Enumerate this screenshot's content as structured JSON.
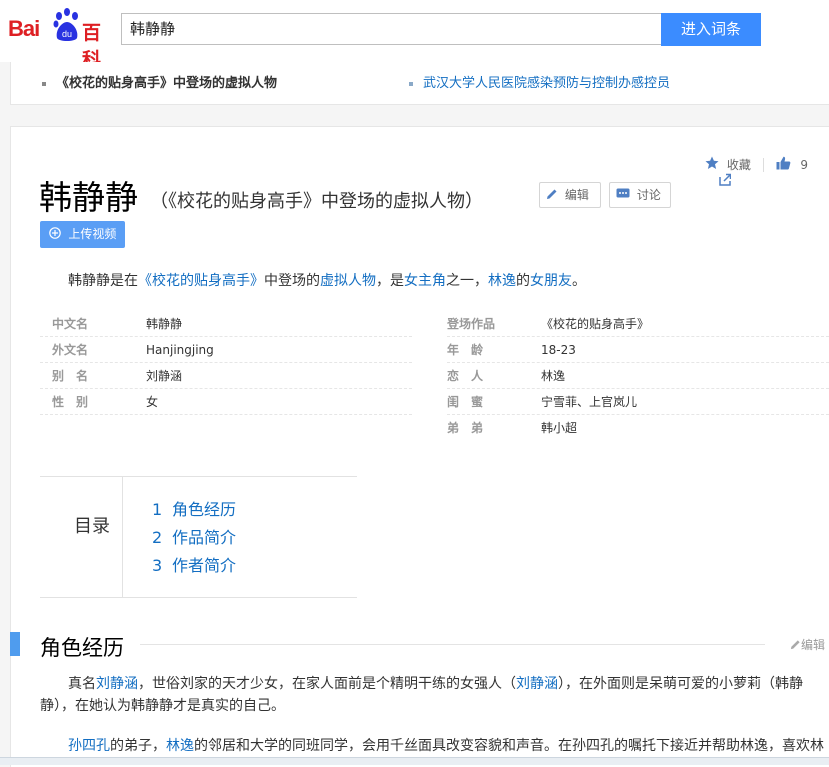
{
  "brand": {
    "bai": "Bai",
    "du": "du",
    "baike": "百科"
  },
  "search": {
    "value": "韩静静",
    "button": "进入词条"
  },
  "polysemy": [
    {
      "label": "《校花的贴身高手》中登场的虚拟人物"
    },
    {
      "label": "武汉大学人民医院感染预防与控制办感控员"
    }
  ],
  "tools": {
    "collect": "收藏",
    "like_count": "9"
  },
  "lemma": {
    "title": "韩静静",
    "subtitle": "（《校花的贴身高手》中登场的虚拟人物）",
    "edit": "编辑",
    "discuss": "讨论",
    "upload": "上传视频"
  },
  "summary": {
    "p1": "韩静静是在",
    "l1": "《校花的贴身高手》",
    "p2": "中登场的",
    "l2": "虚拟人物",
    "p3": "，是",
    "l3": "女主角",
    "p4": "之一，",
    "l4": "林逸",
    "p5": "的",
    "l5": "女朋友",
    "p6": "。"
  },
  "basic_info": {
    "left": [
      {
        "key": "中文名",
        "value": "韩静静"
      },
      {
        "key": "外文名",
        "value": "Hanjingjing"
      },
      {
        "key": "别　名",
        "value": "刘静涵"
      },
      {
        "key": "性　别",
        "value": "女"
      }
    ],
    "right": [
      {
        "key": "登场作品",
        "value": "《校花的贴身高手》"
      },
      {
        "key": "年　龄",
        "value": "18-23"
      },
      {
        "key": "恋　人",
        "value": "林逸"
      },
      {
        "key": "闺　蜜",
        "value": "宁雪菲、上官岚儿"
      },
      {
        "key": "弟　弟",
        "value": "韩小超"
      }
    ]
  },
  "catalog": {
    "title": "目录",
    "items": [
      {
        "num": "1",
        "label": "角色经历"
      },
      {
        "num": "2",
        "label": "作品简介"
      },
      {
        "num": "3",
        "label": "作者简介"
      }
    ]
  },
  "section": {
    "title": "角色经历",
    "edit": "编辑",
    "para1": {
      "a": "真名",
      "l1": "刘静涵",
      "b": "，世俗刘家的天才少女，在家人面前是个精明干练的女强人（",
      "l2": "刘静涵",
      "c": "），在外面则是呆萌可爱的小萝莉（韩静静），在她认为韩静静才是真实的自己。"
    },
    "para2": {
      "l1": "孙四孔",
      "a": "的弟子，",
      "l2": "林逸",
      "b": "的邻居和大学的同班同学，会用千丝面具改变容貌和声音。在孙四孔的嘱托下接近并帮助林逸，喜欢林"
    }
  },
  "colors": {
    "accent": "#3b8cff",
    "link": "#136ec2",
    "brand": "#de1f23"
  }
}
